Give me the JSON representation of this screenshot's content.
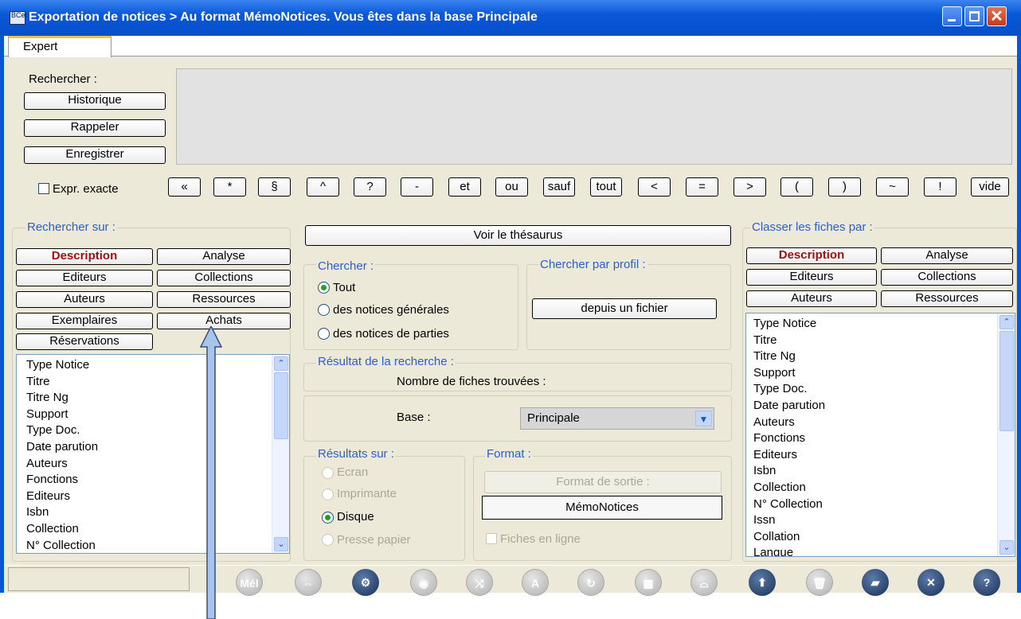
{
  "window": {
    "title": "Exportation de notices > Au format MémoNotices.  Vous êtes dans la base Principale",
    "app_icon_text": "BCel"
  },
  "tabs": [
    {
      "label": "Expert",
      "active": true
    }
  ],
  "search": {
    "label": "Rechercher :",
    "history_button": "Historique",
    "recall_button": "Rappeler",
    "save_button": "Enregistrer",
    "exact_expr_label": "Expr. exacte",
    "operators": [
      "«",
      "*",
      "§",
      "^",
      "?",
      "-",
      "et",
      "ou",
      "sauf",
      "tout",
      "<",
      "=",
      ">",
      "(",
      ")",
      "~",
      "!",
      "vide"
    ]
  },
  "search_on": {
    "label": "Rechercher sur :",
    "buttons": [
      "Description",
      "Analyse",
      "Editeurs",
      "Collections",
      "Auteurs",
      "Ressources",
      "Exemplaires",
      "Achats",
      "Réservations"
    ],
    "fields": [
      "Type Notice",
      "Titre",
      "Titre Ng",
      "Support",
      "Type Doc.",
      "Date parution",
      "Auteurs",
      "Fonctions",
      "Editeurs",
      "Isbn",
      "Collection",
      "N° Collection"
    ]
  },
  "center": {
    "thesaurus_button": "Voir le thésaurus",
    "search_group": {
      "label": "Chercher :",
      "options": [
        "Tout",
        "des notices générales",
        "des notices de parties"
      ],
      "selected": "Tout"
    },
    "profile_group": {
      "label": "Chercher par profil :",
      "button": "depuis un fichier"
    },
    "result_group": {
      "label": "Résultat de la recherche :",
      "count_label": "Nombre de fiches trouvées :"
    },
    "base": {
      "label": "Base :",
      "value": "Principale"
    },
    "results_on": {
      "label": "Résultats sur :",
      "options": [
        "Ecran",
        "Imprimante",
        "Disque",
        "Presse papier"
      ],
      "selected": "Disque"
    },
    "format": {
      "label": "Format :",
      "output_label": "Format de sortie :",
      "value": "MémoNotices",
      "online_label": "Fiches en ligne"
    }
  },
  "sort_by": {
    "label": "Classer les fiches par :",
    "buttons": [
      "Description",
      "Analyse",
      "Editeurs",
      "Collections",
      "Auteurs",
      "Ressources"
    ],
    "fields": [
      "Type Notice",
      "Titre",
      "Titre Ng",
      "Support",
      "Type Doc.",
      "Date parution",
      "Auteurs",
      "Fonctions",
      "Editeurs",
      "Isbn",
      "Collection",
      "N° Collection",
      "Issn",
      "Collation",
      "Langue"
    ]
  },
  "toolbar": {
    "mail_label": "Mél"
  },
  "icons": [
    "mail-icon",
    "refresh-icon",
    "gears-icon",
    "eye-icon",
    "shuffle-icon",
    "spellcheck-icon",
    "cycle-icon",
    "grid-icon",
    "bowl-icon",
    "export-icon",
    "trash-icon",
    "note-icon",
    "close-icon",
    "help-icon"
  ]
}
